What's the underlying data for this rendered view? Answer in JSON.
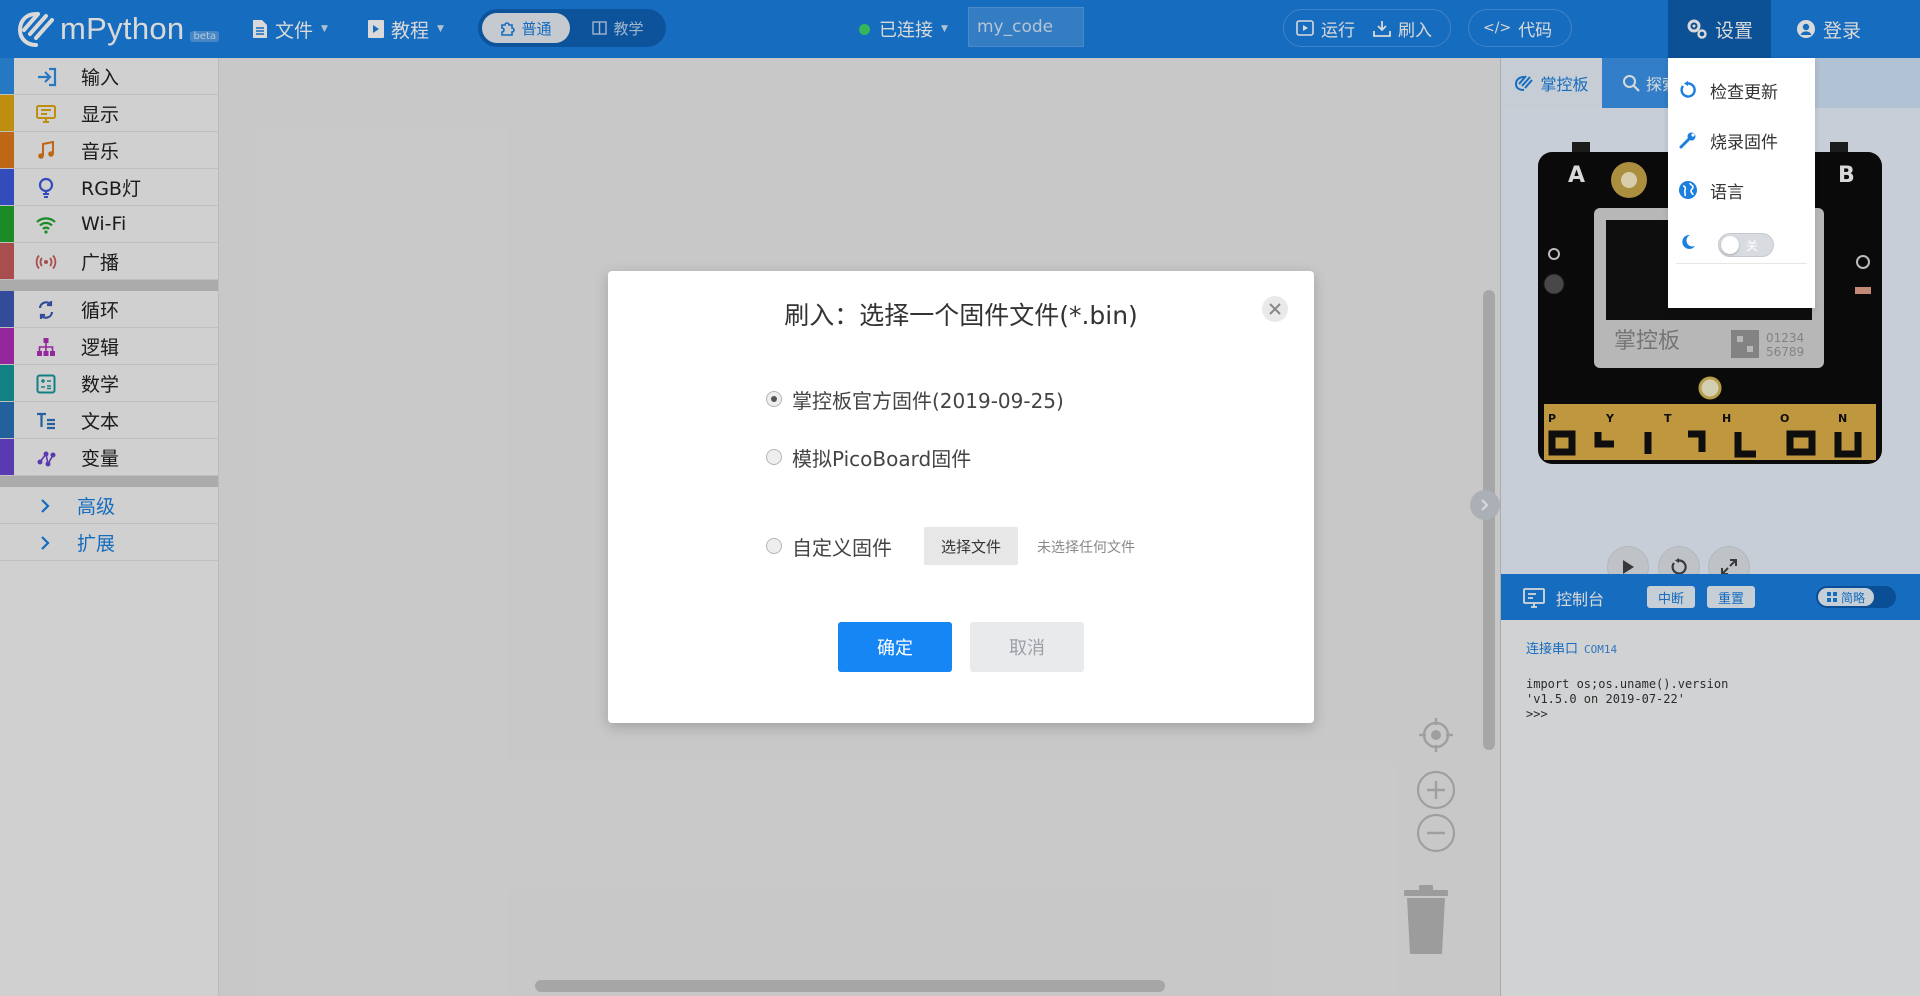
{
  "app": {
    "name": "mPython",
    "badge": "beta"
  },
  "topbar": {
    "file_menu": "文件",
    "tutorial_menu": "教程",
    "mode_normal": "普通",
    "mode_teach": "教学",
    "connection_status": "已连接",
    "filename": "my_code",
    "run": "运行",
    "flash": "刷入",
    "code": "代码",
    "settings": "设置",
    "login": "登录"
  },
  "sidebar": {
    "categories": [
      {
        "label": "输入",
        "color": "#2e8ee6"
      },
      {
        "label": "显示",
        "color": "#e0a712"
      },
      {
        "label": "音乐",
        "color": "#e07a1a"
      },
      {
        "label": "RGB灯",
        "color": "#3b5bdc"
      },
      {
        "label": "Wi-Fi",
        "color": "#21a32c"
      },
      {
        "label": "广播",
        "color": "#c75c5c"
      },
      {
        "label": "循环",
        "color": "#3c59b4"
      },
      {
        "label": "逻辑",
        "color": "#b02eb8"
      },
      {
        "label": "数学",
        "color": "#16989a"
      },
      {
        "label": "文本",
        "color": "#2a73b8"
      },
      {
        "label": "变量",
        "color": "#6a45d0"
      }
    ],
    "advanced": "高级",
    "extensions": "扩展"
  },
  "settings_menu": {
    "check_update": "检查更新",
    "burn_firmware": "烧录固件",
    "language": "语言",
    "theme_switch": "关"
  },
  "right_panel": {
    "tab_board": "掌控板",
    "tab_explore": "探索",
    "board": {
      "label_a": "A",
      "label_b": "B",
      "brand": "掌控板",
      "digits_top": "01234",
      "digits_bottom": "56789",
      "pins": [
        "P",
        "Y",
        "T",
        "H",
        "O",
        "N"
      ]
    },
    "console": {
      "title": "控制台",
      "interrupt": "中断",
      "reset": "重置",
      "simple": "简略",
      "connected_label": "连接串口",
      "port": "COM14",
      "lines": [
        "import os;os.uname().version",
        "'v1.5.0 on 2019-07-22'",
        ">>>"
      ]
    }
  },
  "dialog": {
    "title": "刷入：选择一个固件文件(*.bin)",
    "options": [
      {
        "label": "掌控板官方固件(2019-09-25)",
        "checked": true
      },
      {
        "label": "模拟PicoBoard固件",
        "checked": false
      },
      {
        "label": "自定义固件",
        "checked": false
      }
    ],
    "choose_file": "选择文件",
    "no_file": "未选择任何文件",
    "ok": "确定",
    "cancel": "取消"
  }
}
